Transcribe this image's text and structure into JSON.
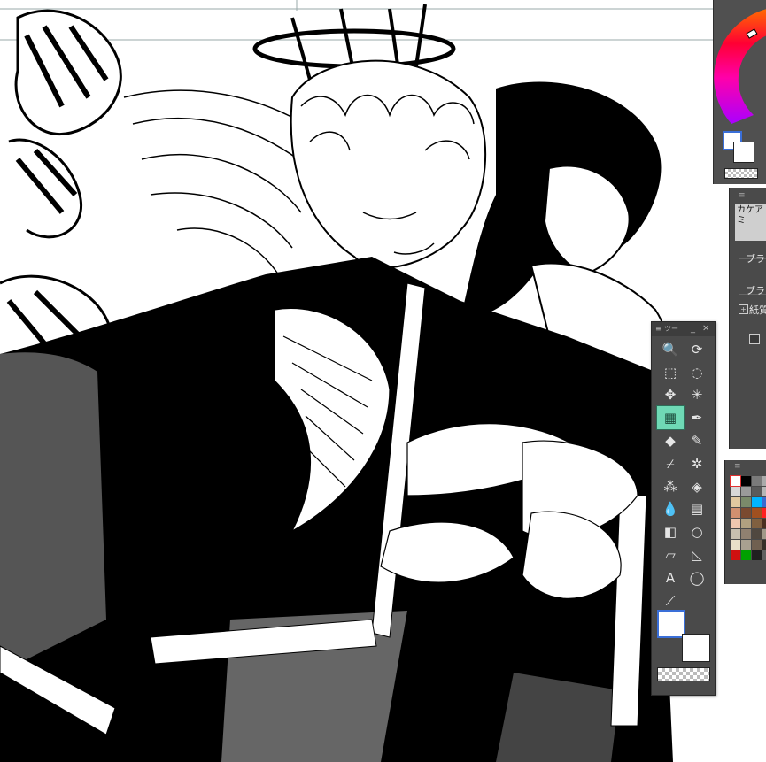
{
  "tool_palette": {
    "title": "ツー",
    "minimize_label": "_",
    "close_label": "✕",
    "tools": [
      {
        "name": "zoom-tool",
        "icon": "🔍"
      },
      {
        "name": "operation-tool",
        "icon": "⟳"
      },
      {
        "name": "object-tool",
        "icon": "⬚"
      },
      {
        "name": "lasso-select-tool",
        "icon": "◌"
      },
      {
        "name": "move-tool",
        "icon": "✥"
      },
      {
        "name": "auto-select-tool",
        "icon": "✳"
      },
      {
        "name": "screentone-tool",
        "icon": "▦",
        "active": true
      },
      {
        "name": "pen-tool",
        "icon": "✒"
      },
      {
        "name": "eraser-tool",
        "icon": "◆"
      },
      {
        "name": "pencil-tool",
        "icon": "✎"
      },
      {
        "name": "eyedropper-tool",
        "icon": "⌿"
      },
      {
        "name": "decoration-tool",
        "icon": "✲"
      },
      {
        "name": "airbrush-tool",
        "icon": "⁂"
      },
      {
        "name": "fill-tool",
        "icon": "◈"
      },
      {
        "name": "blend-tool",
        "icon": "💧"
      },
      {
        "name": "grid-tool",
        "icon": "▤"
      },
      {
        "name": "gradient-tool",
        "icon": "◧"
      },
      {
        "name": "figure-tool",
        "icon": "○"
      },
      {
        "name": "frame-tool",
        "icon": "▱"
      },
      {
        "name": "ruler-tool",
        "icon": "◺"
      },
      {
        "name": "text-tool",
        "icon": "A"
      },
      {
        "name": "balloon-tool",
        "icon": "◯"
      },
      {
        "name": "correct-line-tool",
        "icon": "⟋"
      }
    ]
  },
  "brush_panel": {
    "header": "カケアミ",
    "rows": [
      "ブラ",
      "ブラ",
      "紙質"
    ]
  },
  "colors": {
    "panel_bg": "#4a4a4a",
    "active_tool": "#6fd9b5",
    "selection_border": "#3a6fd8"
  },
  "color_set": [
    "#ffffff",
    "#000000",
    "#7a7a7a",
    "#aaaaaa",
    "#d8d8d8",
    "#9a9a9a",
    "#5a5a5a",
    "#b5b5b5",
    "#e0c8a0",
    "#7a8a6a",
    "#00b4ff",
    "#3a6ad0",
    "#d09070",
    "#7a4a30",
    "#a05020",
    "#ff2020",
    "#f0c8b0",
    "#b0a080",
    "#806040",
    "#4a3020",
    "#c8c0b0",
    "#908070",
    "#504840",
    "#a09888",
    "#e8e0c8",
    "#a8a090",
    "#706050",
    "#383028",
    "#d01010",
    "#00a000",
    "#202020",
    "#606060"
  ]
}
